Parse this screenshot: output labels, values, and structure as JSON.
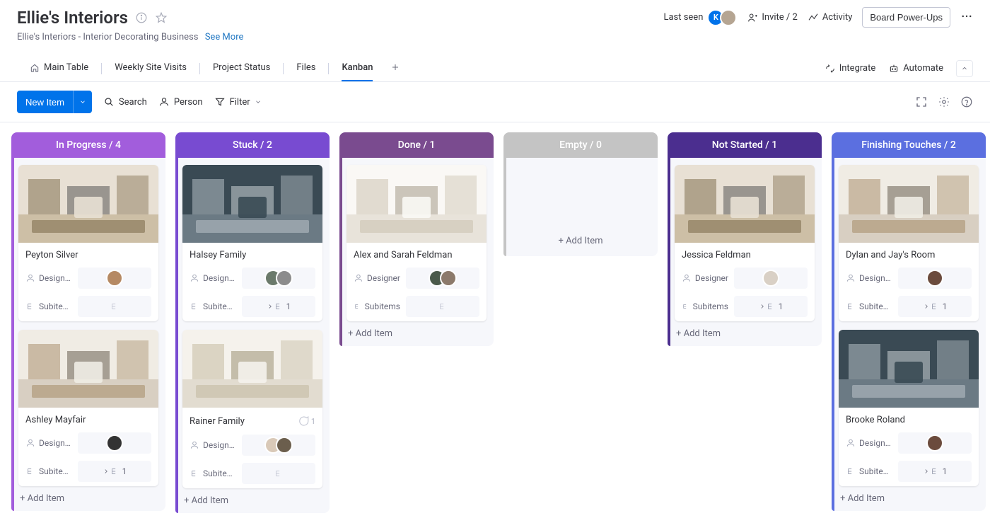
{
  "header": {
    "title": "Ellie's Interiors",
    "subtitle": "Ellie's Interiors - Interior Decorating Business",
    "see_more": "See More",
    "last_seen": "Last seen",
    "invite": "Invite / 2",
    "activity": "Activity",
    "powerups": "Board Power-Ups"
  },
  "tabs": {
    "main": "Main Table",
    "weekly": "Weekly Site Visits",
    "status": "Project Status",
    "files": "Files",
    "kanban": "Kanban",
    "integrate": "Integrate",
    "automate": "Automate"
  },
  "toolbar": {
    "new_item": "New Item",
    "search": "Search",
    "person": "Person",
    "filter": "Filter"
  },
  "labels": {
    "designer": "Designer",
    "designer_short": "Design…",
    "subitems": "Subitems",
    "subitems_short": "Subite…",
    "add_item": "+ Add Item"
  },
  "columns": [
    {
      "name": "In Progress",
      "count": 4,
      "color": "#a25ddc",
      "cards": [
        {
          "title": "Peyton Silver",
          "avatars": [
            "#b58963"
          ],
          "sub": null,
          "hasConversation": false
        },
        {
          "title": "Ashley Mayfair",
          "avatars": [
            "#333333"
          ],
          "sub": 1,
          "hasConversation": false
        }
      ]
    },
    {
      "name": "Stuck",
      "count": 2,
      "color": "#784bd1",
      "cards": [
        {
          "title": "Halsey Family",
          "avatars": [
            "#6b7a6b",
            "#8c8c8c"
          ],
          "sub": 1,
          "hasConversation": false
        },
        {
          "title": "Rainer Family",
          "avatars": [
            "#d9c9b8",
            "#6b5e4d"
          ],
          "sub": null,
          "hasConversation": true
        }
      ]
    },
    {
      "name": "Done",
      "count": 1,
      "color": "#7a4b8f",
      "cards": [
        {
          "title": "Alex and Sarah Feldman",
          "avatars": [
            "#4b5a4b",
            "#8c7a6b"
          ],
          "sub": null,
          "hasConversation": false
        }
      ]
    },
    {
      "name": "Empty",
      "count": 0,
      "color": "#c4c4c4",
      "cards": []
    },
    {
      "name": "Not Started",
      "count": 1,
      "color": "#4b2e8f",
      "cards": [
        {
          "title": "Jessica Feldman",
          "avatars": [
            "#d9d0c5"
          ],
          "sub": 1,
          "hasConversation": false
        }
      ]
    },
    {
      "name": "Finishing Touches",
      "count": 2,
      "color": "#5b6fe0",
      "cards": [
        {
          "title": "Dylan and Jay's Room",
          "avatars": [
            "#6b4b3d"
          ],
          "sub": 1,
          "hasConversation": false
        },
        {
          "title": "Brooke Roland",
          "avatars": [
            "#6b4b3d"
          ],
          "sub": 1,
          "hasConversation": false
        }
      ]
    }
  ]
}
